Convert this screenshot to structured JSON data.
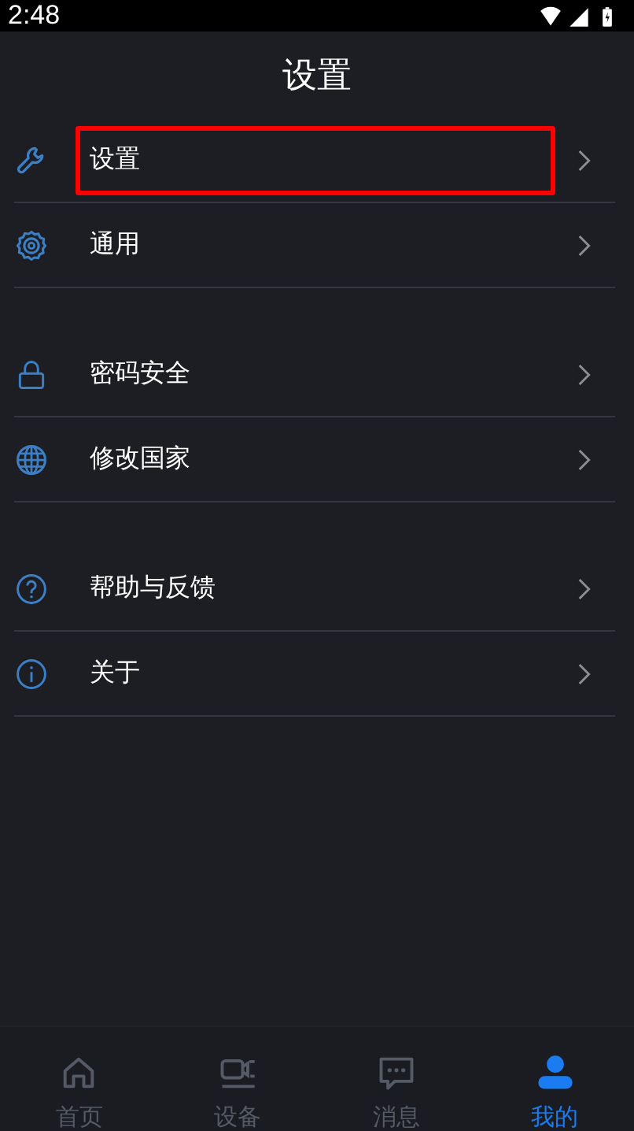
{
  "status_bar": {
    "time": "2:48"
  },
  "header": {
    "title": "设置"
  },
  "groups": [
    {
      "items": [
        {
          "kind": "wrench",
          "label": "设置",
          "highlighted": true
        },
        {
          "kind": "gear",
          "label": "通用",
          "highlighted": false
        }
      ]
    },
    {
      "items": [
        {
          "kind": "lock",
          "label": "密码安全",
          "highlighted": false
        },
        {
          "kind": "globe",
          "label": "修改国家",
          "highlighted": false
        }
      ]
    },
    {
      "items": [
        {
          "kind": "help",
          "label": "帮助与反馈",
          "highlighted": false
        },
        {
          "kind": "info",
          "label": "关于",
          "highlighted": false
        }
      ]
    }
  ],
  "tab_bar": [
    {
      "kind": "home",
      "label": "首页",
      "selected": false
    },
    {
      "kind": "camera",
      "label": "设备",
      "selected": false
    },
    {
      "kind": "chat",
      "label": "消息",
      "selected": false
    },
    {
      "kind": "person",
      "label": "我的",
      "selected": true
    }
  ]
}
